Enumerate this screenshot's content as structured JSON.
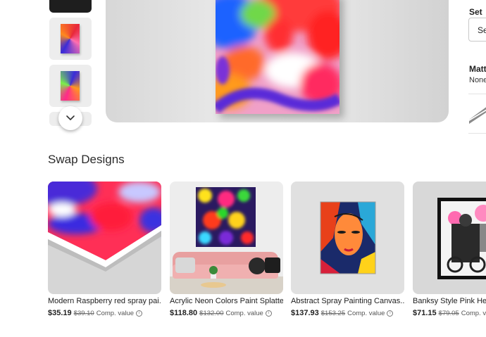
{
  "right_panel": {
    "set_label": "Set",
    "set_value": "Se",
    "matte_label": "Matt",
    "matte_value": "None"
  },
  "swap": {
    "title": "Swap Designs",
    "cards": [
      {
        "name": "Modern Raspberry red spray pai...",
        "price": "$35.19",
        "old_price": "$39.10",
        "comp": "Comp. value"
      },
      {
        "name": "Acrylic Neon Colors Paint Splatte...",
        "price": "$118.80",
        "old_price": "$132.00",
        "comp": "Comp. value"
      },
      {
        "name": "Abstract Spray Painting Canvas...",
        "price": "$137.93",
        "old_price": "$153.25",
        "comp": "Comp. value"
      },
      {
        "name": "Banksy Style Pink Helm",
        "price": "$71.15",
        "old_price": "$79.05",
        "comp": "Comp. valu"
      }
    ]
  },
  "icons": {
    "scroll_down": "chevron-down-icon",
    "info": "info-icon"
  },
  "colors": {
    "accent_red": "#e8283a",
    "accent_blue": "#2b2ad8",
    "text": "#212121"
  }
}
